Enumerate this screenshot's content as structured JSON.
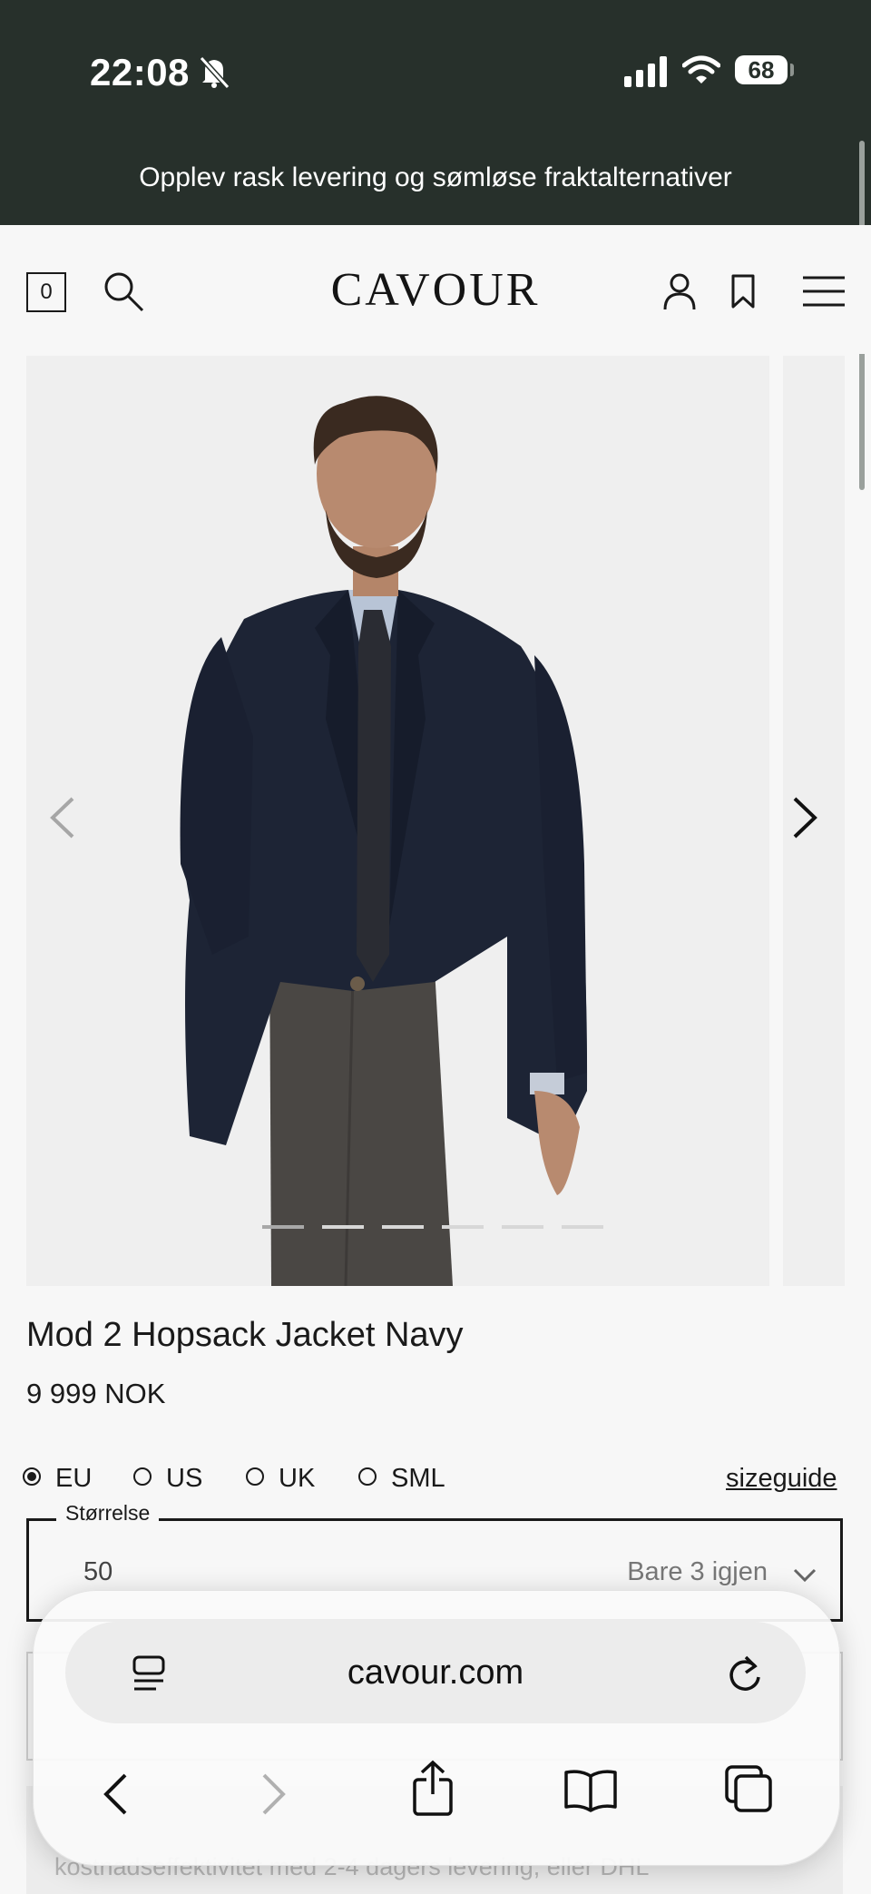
{
  "status_bar": {
    "time": "22:08",
    "battery": "68",
    "icons": [
      "bell-slash-icon",
      "signal-icon",
      "wifi-icon",
      "battery-icon"
    ]
  },
  "promo": {
    "text": "Opplev rask levering og sømløse fraktalternativer"
  },
  "header": {
    "cart_count": "0",
    "logo": "CAVOUR",
    "icons": [
      "search-icon",
      "account-icon",
      "bookmark-icon",
      "menu-icon"
    ]
  },
  "gallery": {
    "slide_count": 6,
    "active_slide": 1,
    "image_alt": "Model wearing navy hopsack jacket"
  },
  "product": {
    "title": "Mod 2 Hopsack Jacket Navy",
    "price": "9 999 NOK"
  },
  "size_systems": {
    "options": [
      "EU",
      "US",
      "UK",
      "SML"
    ],
    "selected": "EU",
    "guide_label": "sizeguide"
  },
  "size_select": {
    "legend": "Størrelse",
    "value": "50",
    "stock": "Bare 3 igjen"
  },
  "behind_text": "kostnadseffektivitet med 2-4 dagers levering, eller DHL",
  "browser": {
    "url": "cavour.com"
  },
  "colors": {
    "status_bg": "#27302b",
    "page_bg": "#f7f7f7",
    "text": "#1a1a1a"
  }
}
